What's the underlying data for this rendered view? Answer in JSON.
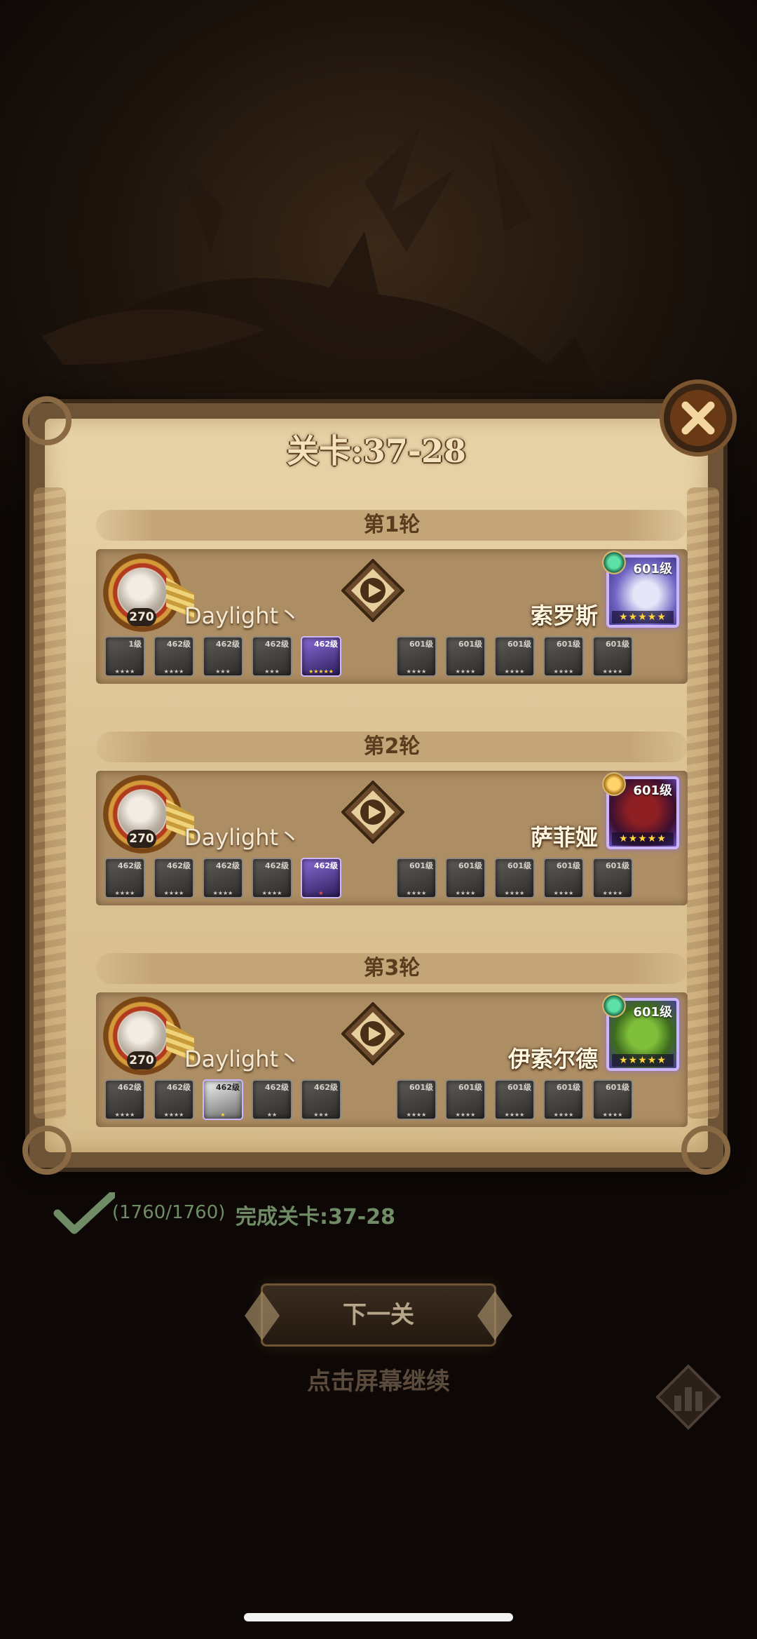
{
  "stage_title": "关卡:37-28",
  "rounds": [
    {
      "label": "第1轮",
      "player_name": "Daylight丶",
      "player_level": "270",
      "enemy_name": "索罗斯",
      "boss_level": "601级",
      "boss_stars": "★★★★★",
      "player_slots": [
        "1级",
        "462级",
        "462级",
        "462级",
        "462级"
      ],
      "enemy_slots": [
        "601级",
        "601级",
        "601级",
        "601级",
        "601级"
      ]
    },
    {
      "label": "第2轮",
      "player_name": "Daylight丶",
      "player_level": "270",
      "enemy_name": "萨菲娅",
      "boss_level": "601级",
      "boss_stars": "★★★★★",
      "player_slots": [
        "462级",
        "462级",
        "462级",
        "462级",
        "462级"
      ],
      "enemy_slots": [
        "601级",
        "601级",
        "601级",
        "601级",
        "601级"
      ]
    },
    {
      "label": "第3轮",
      "player_name": "Daylight丶",
      "player_level": "270",
      "enemy_name": "伊索尔德",
      "boss_level": "601级",
      "boss_stars": "★★★★★",
      "player_slots": [
        "462级",
        "462级",
        "462级",
        "462级",
        "462级"
      ],
      "enemy_slots": [
        "601级",
        "601级",
        "601级",
        "601级",
        "601级"
      ]
    }
  ],
  "footer": {
    "exp": "(1760/1760)",
    "complete": "完成关卡:37-28",
    "next_button": "下一关",
    "tap_hint": "点击屏幕继续"
  }
}
